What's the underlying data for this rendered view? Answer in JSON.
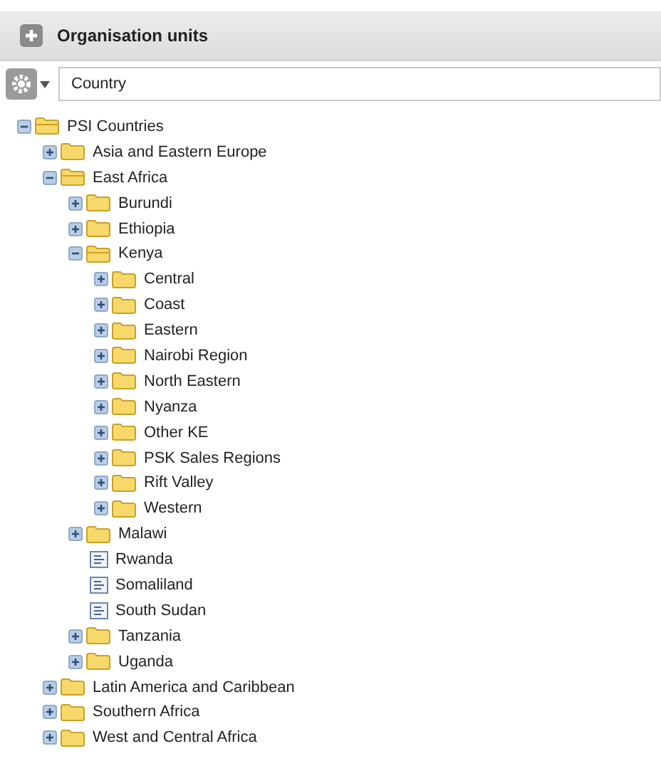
{
  "panel": {
    "title": "Organisation units"
  },
  "toolbar": {
    "field_value": "Country"
  },
  "tree": [
    {
      "label": "PSI Countries",
      "kind": "folder",
      "expanded": true,
      "children": [
        {
          "label": "Asia and Eastern Europe",
          "kind": "folder",
          "expanded": false
        },
        {
          "label": "East Africa",
          "kind": "folder",
          "expanded": true,
          "children": [
            {
              "label": "Burundi",
              "kind": "folder",
              "expanded": false
            },
            {
              "label": "Ethiopia",
              "kind": "folder",
              "expanded": false
            },
            {
              "label": "Kenya",
              "kind": "folder",
              "expanded": true,
              "children": [
                {
                  "label": "Central",
                  "kind": "folder",
                  "expanded": false
                },
                {
                  "label": "Coast",
                  "kind": "folder",
                  "expanded": false
                },
                {
                  "label": "Eastern",
                  "kind": "folder",
                  "expanded": false
                },
                {
                  "label": "Nairobi Region",
                  "kind": "folder",
                  "expanded": false
                },
                {
                  "label": "North Eastern",
                  "kind": "folder",
                  "expanded": false
                },
                {
                  "label": "Nyanza",
                  "kind": "folder",
                  "expanded": false
                },
                {
                  "label": "Other KE",
                  "kind": "folder",
                  "expanded": false
                },
                {
                  "label": "PSK Sales Regions",
                  "kind": "folder",
                  "expanded": false
                },
                {
                  "label": "Rift Valley",
                  "kind": "folder",
                  "expanded": false
                },
                {
                  "label": "Western",
                  "kind": "folder",
                  "expanded": false
                }
              ]
            },
            {
              "label": "Malawi",
              "kind": "folder",
              "expanded": false
            },
            {
              "label": "Rwanda",
              "kind": "leaf"
            },
            {
              "label": "Somaliland",
              "kind": "leaf"
            },
            {
              "label": "South Sudan",
              "kind": "leaf"
            },
            {
              "label": "Tanzania",
              "kind": "folder",
              "expanded": false
            },
            {
              "label": "Uganda",
              "kind": "folder",
              "expanded": false
            }
          ]
        },
        {
          "label": "Latin America and Caribbean",
          "kind": "folder",
          "expanded": false
        },
        {
          "label": "Southern Africa",
          "kind": "folder",
          "expanded": false
        },
        {
          "label": "West and Central Africa",
          "kind": "folder",
          "expanded": false
        }
      ]
    }
  ]
}
